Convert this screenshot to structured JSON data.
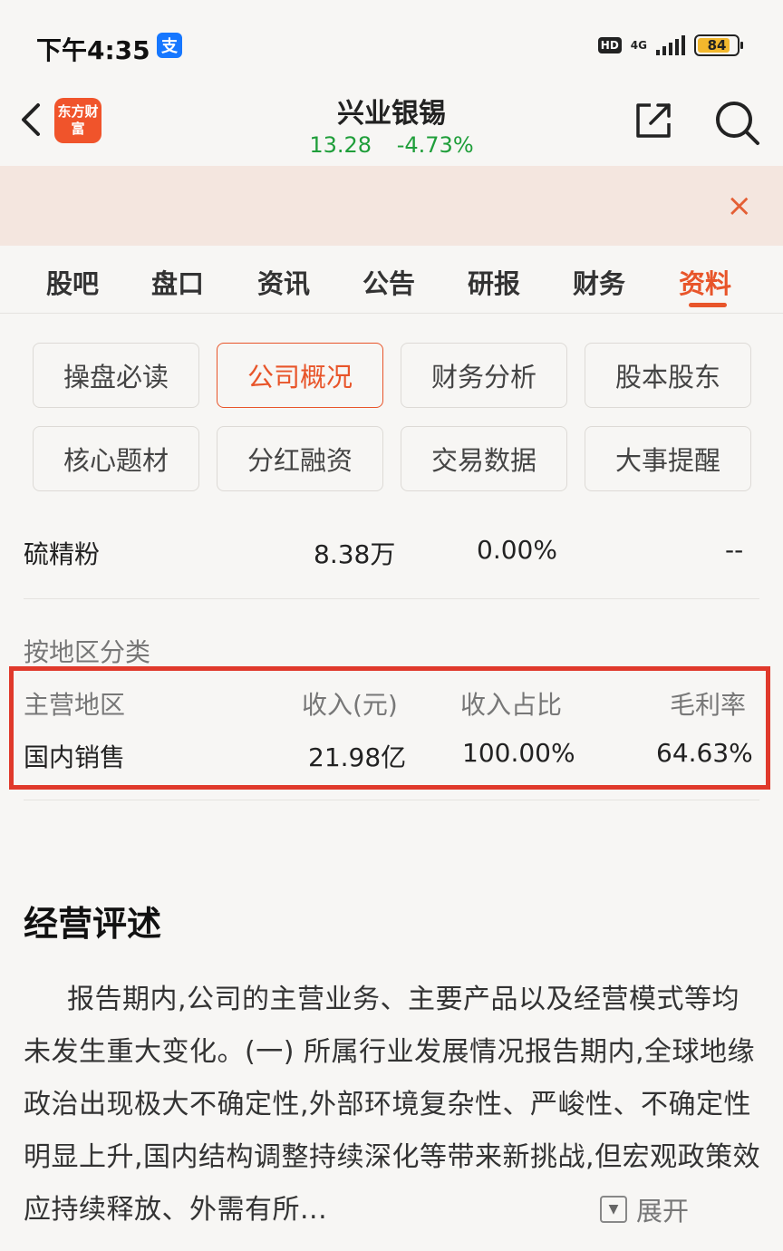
{
  "status_bar": {
    "time": "下午4:35",
    "alipay_badge": "支",
    "hd": "HD",
    "network": "4G",
    "battery": "84",
    "battery_level": 0.84
  },
  "header": {
    "brand": "东方财富",
    "stock_name": "兴业银锡",
    "price": "13.28",
    "change": "-4.73%"
  },
  "banner": {
    "close": "×"
  },
  "tabs": [
    {
      "label": "股吧"
    },
    {
      "label": "盘口"
    },
    {
      "label": "资讯"
    },
    {
      "label": "公告"
    },
    {
      "label": "研报"
    },
    {
      "label": "财务"
    },
    {
      "label": "资料",
      "active": true
    }
  ],
  "sub_tabs": [
    {
      "label": "操盘必读"
    },
    {
      "label": "公司概况",
      "active": true
    },
    {
      "label": "财务分析"
    },
    {
      "label": "股本股东"
    },
    {
      "label": "核心题材"
    },
    {
      "label": "分红融资"
    },
    {
      "label": "交易数据"
    },
    {
      "label": "大事提醒"
    }
  ],
  "product_row": {
    "name": "硫精粉",
    "revenue": "8.38万",
    "ratio": "0.00%",
    "margin": "--"
  },
  "region_section": {
    "label": "按地区分类",
    "headers": {
      "region": "主营地区",
      "revenue": "收入(元)",
      "ratio": "收入占比",
      "margin": "毛利率"
    },
    "rows": [
      {
        "region": "国内销售",
        "revenue": "21.98亿",
        "ratio": "100.00%",
        "margin": "64.63%"
      }
    ]
  },
  "review": {
    "title": "经营评述",
    "text": "报告期内,公司的主营业务、主要产品以及经营模式等均未发生重大变化。(一) 所属行业发展情况报告期内,全球地缘政治出现极大不确定性,外部环境复杂性、严峻性、不确定性明显上升,国内结构调整持续深化等带来新挑战,但宏观政策效应持续释放、外需有所...",
    "expand_label": "展开"
  },
  "colors": {
    "accent": "#e8552a",
    "down": "#1f9e3a",
    "highlight": "#e0392b"
  }
}
